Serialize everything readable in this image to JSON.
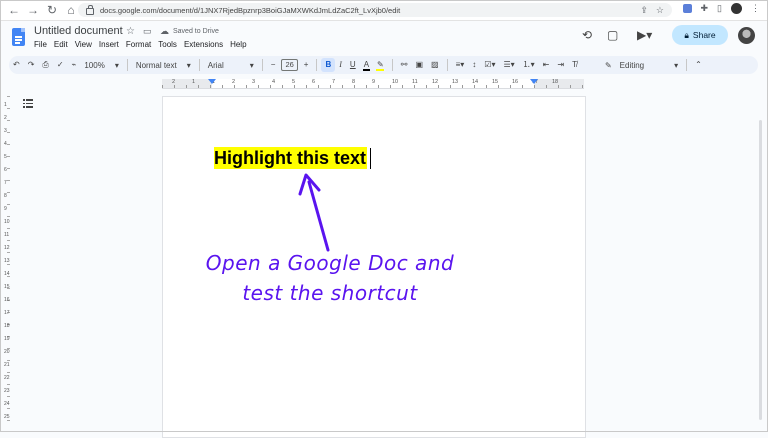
{
  "browser": {
    "url": "docs.google.com/document/d/1JNX7RjedBpznrp3BoiGJaMXWKdJmLdZaC2ft_LvXjb0/edit"
  },
  "doc": {
    "title": "Untitled document",
    "saved_status": "Saved to Drive",
    "menu": [
      "File",
      "Edit",
      "View",
      "Insert",
      "Format",
      "Tools",
      "Extensions",
      "Help"
    ],
    "share_label": "Share"
  },
  "toolbar": {
    "zoom": "100%",
    "style": "Normal text",
    "font": "Arial",
    "font_size": "26",
    "mode": "Editing",
    "bold_label": "B",
    "italic_label": "I",
    "underline_label": "U",
    "text_color_label": "A"
  },
  "ruler": {
    "h_numbers": [
      "2",
      "1",
      "1",
      "2",
      "3",
      "4",
      "5",
      "6",
      "7",
      "8",
      "9",
      "10",
      "11",
      "12",
      "13",
      "14",
      "15",
      "16",
      "17",
      "18"
    ],
    "v_numbers": [
      "1",
      "2",
      "3",
      "4",
      "5",
      "6",
      "7",
      "8",
      "9",
      "10",
      "11",
      "12",
      "13",
      "14",
      "15",
      "16",
      "17",
      "18",
      "19",
      "20",
      "21",
      "22",
      "23",
      "24",
      "25"
    ]
  },
  "document_body": {
    "highlighted_text": "Highlight this text"
  },
  "annotation": {
    "line1": "Open a Google Doc and",
    "line2": "test the shortcut",
    "color": "#5a14ef"
  },
  "colors": {
    "highlight": "#ffff00",
    "share_bg": "#c2e7ff",
    "docs_blue": "#4285f4"
  }
}
